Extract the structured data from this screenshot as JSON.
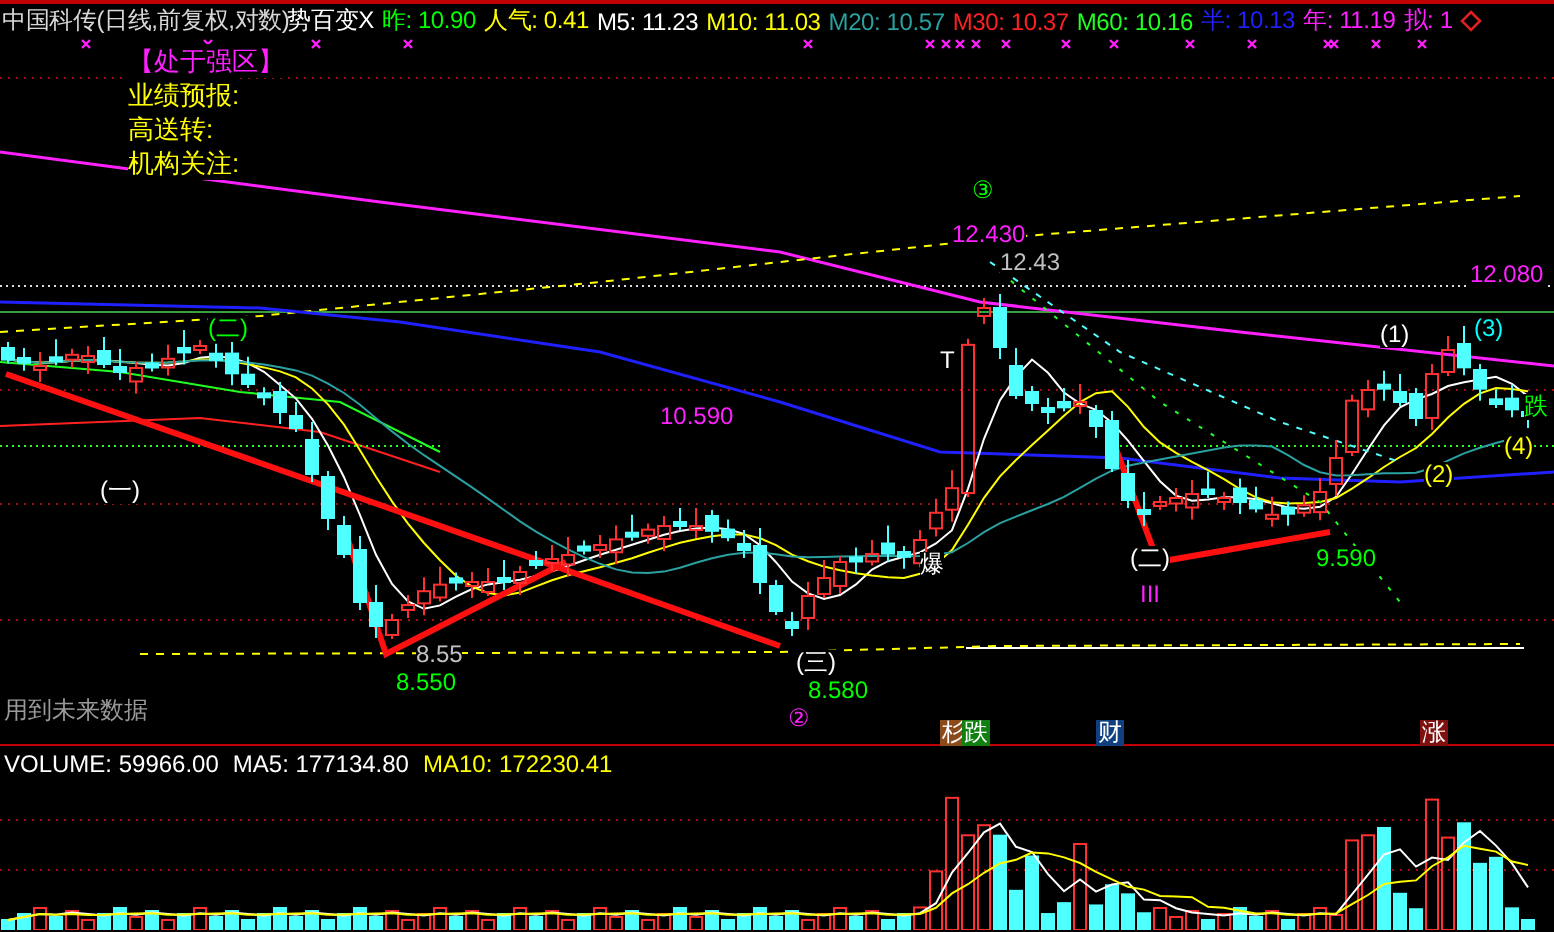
{
  "header": {
    "title": "中国科传(日线,前复权,对数)",
    "indicator": "势百变X",
    "quotes": [
      {
        "text": "昨: 10.90",
        "color": "#00ff00"
      },
      {
        "text": "人气: 0.41",
        "color": "#ffff00"
      },
      {
        "text": "M5: 11.23",
        "color": "#ffffff"
      },
      {
        "text": "M10: 11.03",
        "color": "#ffff00"
      },
      {
        "text": "M20: 10.57",
        "color": "#2aa0a0"
      },
      {
        "text": "M30: 10.37",
        "color": "#ff2020"
      },
      {
        "text": "M60: 10.16",
        "color": "#20ff20"
      },
      {
        "text": "半: 10.13",
        "color": "#2020ff"
      },
      {
        "text": "年: 11.19",
        "color": "#ff20ff"
      },
      {
        "text": "拟: 1",
        "color": "#ff20ff"
      }
    ]
  },
  "info_panel": {
    "zone": "【处于强区】",
    "fields": [
      "业绩预报:",
      "高送转:",
      "机构关注:"
    ]
  },
  "chart_annotations": [
    {
      "text": "③",
      "color": "#00ff00"
    },
    {
      "text": "12.430",
      "color": "#ff20ff"
    },
    {
      "text": "12.43",
      "color": "#c0c0c0"
    },
    {
      "text": "12.080",
      "color": "#ff20ff"
    },
    {
      "text": "(二)",
      "color": "#00ff00"
    },
    {
      "text": "(1)",
      "color": "#ffffff"
    },
    {
      "text": "(3)",
      "color": "#00ffff"
    },
    {
      "text": "T",
      "color": "#ffffff"
    },
    {
      "text": "跌",
      "color": "#00ff00"
    },
    {
      "text": "10.590",
      "color": "#ff20ff"
    },
    {
      "text": "(4)",
      "color": "#ffff00"
    },
    {
      "text": "(2)",
      "color": "#ffff00"
    },
    {
      "text": "(一)",
      "color": "#ffffff"
    },
    {
      "text": "爆",
      "color": "#ffffff"
    },
    {
      "text": "(二)",
      "color": "#ffffff"
    },
    {
      "text": "9.590",
      "color": "#00ff00"
    },
    {
      "text": "III",
      "color": "#ff20ff"
    },
    {
      "text": "8.55",
      "color": "#c0c0c0"
    },
    {
      "text": "(三)",
      "color": "#ffffff"
    },
    {
      "text": "8.550",
      "color": "#00ff00"
    },
    {
      "text": "8.580",
      "color": "#00ff00"
    },
    {
      "text": "②",
      "color": "#ff20ff"
    }
  ],
  "notice": "用到未来数据",
  "event_markers": [
    {
      "text": "杉",
      "color": "#8b4a1a"
    },
    {
      "text": "跌",
      "color": "#108010"
    },
    {
      "text": "财",
      "color": "#10407f"
    },
    {
      "text": "涨",
      "color": "#7f1010"
    }
  ],
  "volume": {
    "label": "VOLUME: 59966.00",
    "ma5": "MA5: 177134.80",
    "ma10": "MA10: 172230.41"
  }
}
